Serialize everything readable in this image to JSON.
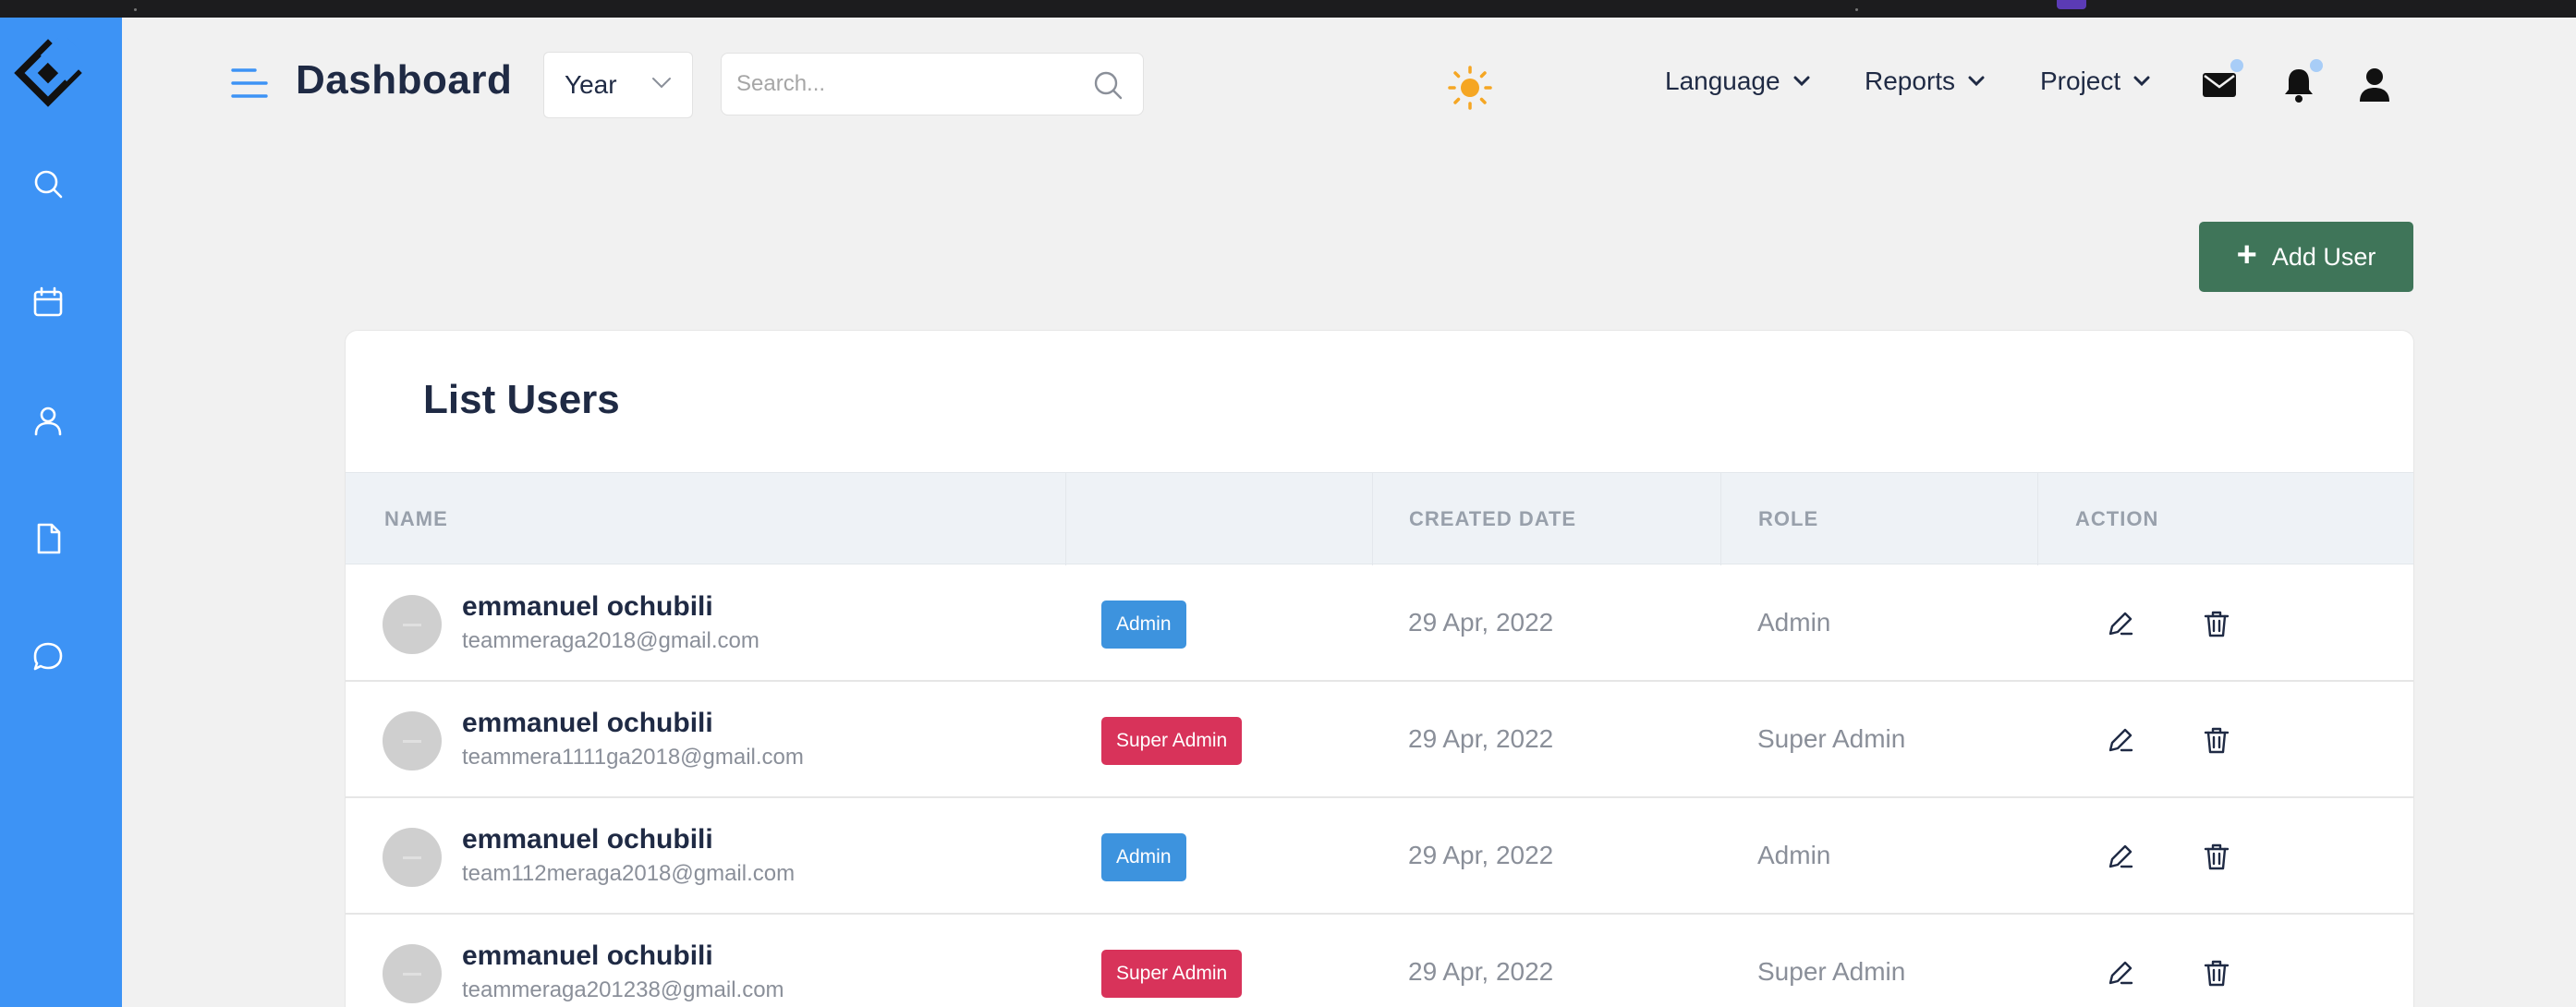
{
  "app": {
    "title": "Dashboard"
  },
  "header": {
    "year_select": "Year",
    "search_placeholder": "Search...",
    "nav": [
      {
        "label": "Language"
      },
      {
        "label": "Reports"
      },
      {
        "label": "Project"
      }
    ]
  },
  "sidebar": {
    "items": [
      {
        "icon": "search-icon"
      },
      {
        "icon": "calendar-icon"
      },
      {
        "icon": "user-icon"
      },
      {
        "icon": "file-icon"
      },
      {
        "icon": "chat-icon"
      }
    ]
  },
  "actions": {
    "add_user_label": "Add User"
  },
  "users_card": {
    "title": "List Users",
    "columns": [
      "NAME",
      "",
      "CREATED DATE",
      "ROLE",
      "ACTION"
    ],
    "rows": [
      {
        "name": "emmanuel ochubili",
        "email": "teammeraga2018@gmail.com",
        "badge": "Admin",
        "created": "29 Apr, 2022",
        "role": "Admin"
      },
      {
        "name": "emmanuel ochubili",
        "email": "teammera1111ga2018@gmail.com",
        "badge": "Super Admin",
        "created": "29 Apr, 2022",
        "role": "Super Admin"
      },
      {
        "name": "emmanuel ochubili",
        "email": "team112meraga2018@gmail.com",
        "badge": "Admin",
        "created": "29 Apr, 2022",
        "role": "Admin"
      },
      {
        "name": "emmanuel ochubili",
        "email": "teammeraga201238@gmail.com",
        "badge": "Super Admin",
        "created": "29 Apr, 2022",
        "role": "Super Admin"
      }
    ]
  },
  "colors": {
    "sidebar": "#3d93f5",
    "add_user_button": "#3f7559",
    "admin_badge": "#3d93de",
    "super_admin_badge": "#d8335a"
  }
}
